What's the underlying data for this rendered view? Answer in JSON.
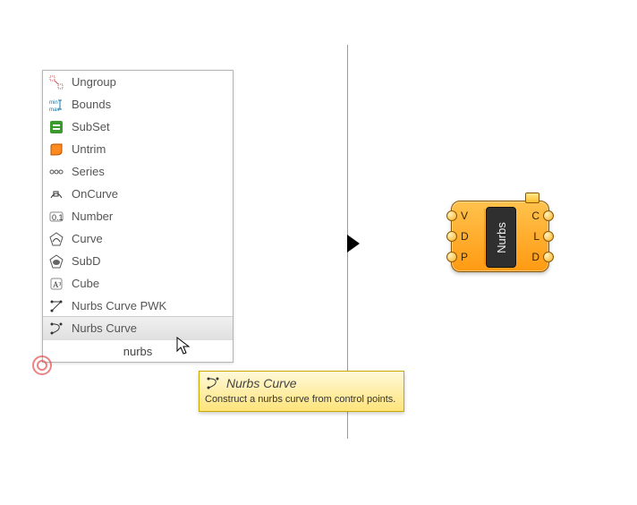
{
  "menu": {
    "search_value": "nurbs",
    "items": [
      {
        "label": "Ungroup"
      },
      {
        "label": "Bounds"
      },
      {
        "label": "SubSet"
      },
      {
        "label": "Untrim"
      },
      {
        "label": "Series"
      },
      {
        "label": "OnCurve"
      },
      {
        "label": "Number"
      },
      {
        "label": "Curve"
      },
      {
        "label": "SubD"
      },
      {
        "label": "Cube"
      },
      {
        "label": "Nurbs Curve PWK"
      },
      {
        "label": "Nurbs Curve"
      }
    ],
    "highlighted_index": 11
  },
  "tooltip": {
    "title": "Nurbs Curve",
    "description": "Construct a nurbs curve from control points."
  },
  "component": {
    "name": "Nurbs",
    "inputs": [
      "V",
      "D",
      "P"
    ],
    "outputs": [
      "C",
      "L",
      "D"
    ],
    "state": "warning"
  },
  "colors": {
    "component_fill_top": "#ffc24d",
    "component_fill_bottom": "#ff9a12",
    "tooltip_fill_top": "#fff9d9",
    "tooltip_fill_bottom": "#ffe47a"
  }
}
